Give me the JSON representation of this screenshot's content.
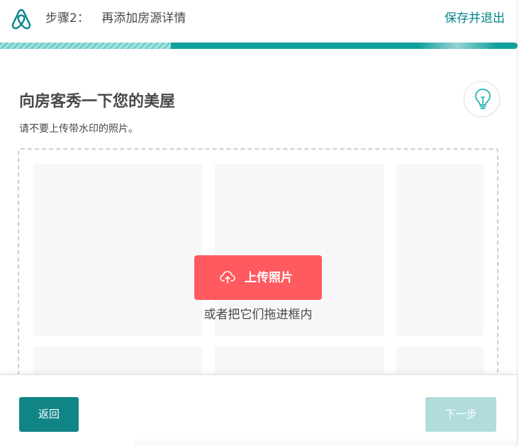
{
  "header": {
    "step_label": "步骤2：",
    "step_title": "再添加房源详情",
    "save_exit_label": "保存并退出",
    "logo_icon": "airbnb-logo-icon"
  },
  "progress": {
    "completed_fraction": 0.33,
    "done_color": "#7dd4d0",
    "track_color": "#12a09e"
  },
  "main": {
    "title": "向房客秀一下您的美屋",
    "subtitle": "请不要上传带水印的照片。",
    "tip_icon": "lightbulb-icon"
  },
  "upload": {
    "button_label": "上传照片",
    "button_icon": "cloud-upload-icon",
    "drag_hint": "或者把它们拖进框内",
    "button_color": "#ff5a5f"
  },
  "footer": {
    "back_label": "返回",
    "next_label": "下一步",
    "back_color": "#118586",
    "next_color": "#b1dcdd"
  }
}
